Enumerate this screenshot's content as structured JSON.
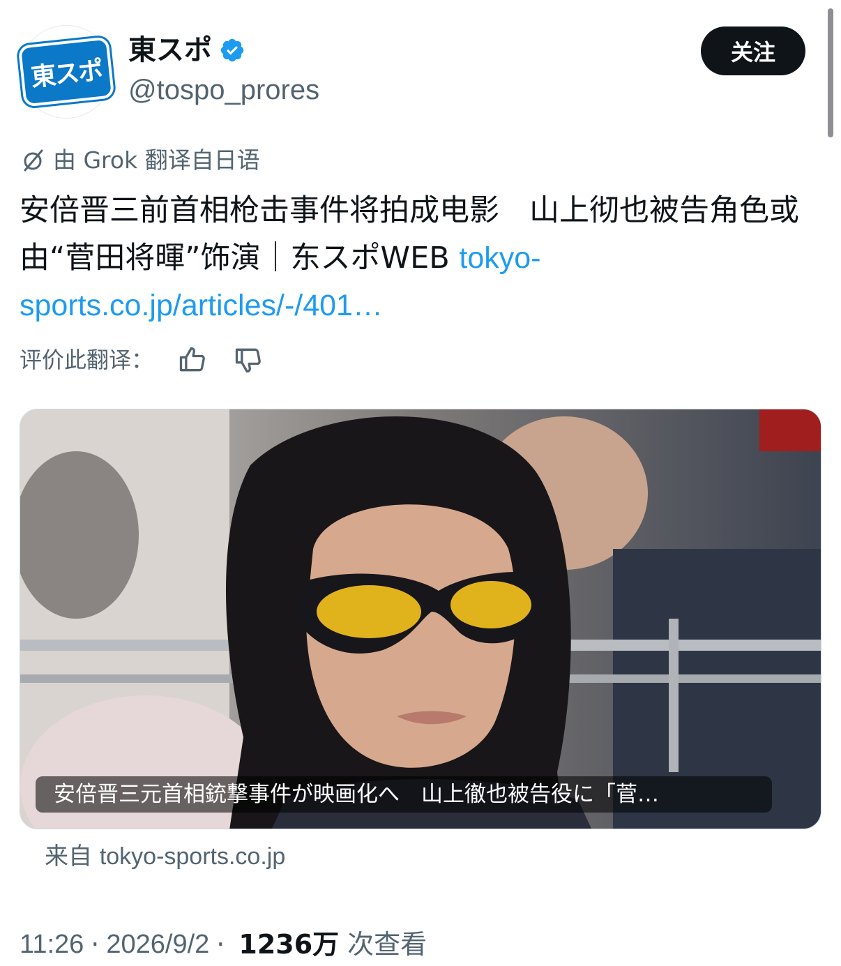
{
  "header": {
    "avatar_text": "東スポ",
    "display_name": "東スポ",
    "handle": "@tospo_prores",
    "follow_label": "关注"
  },
  "translation": {
    "label": "由 Grok 翻译自日语",
    "rate_label": "评价此翻译："
  },
  "tweet": {
    "text": "安倍晋三前首相枪击事件将拍成电影　山上彻也被告角色或由“菅田将暉”饰演｜东スポWEB ",
    "link": "tokyo-sports.co.jp/articles/-/401…"
  },
  "card": {
    "caption": "安倍晋三元首相銃撃事件が映画化へ　山上徹也被告役に「菅…",
    "source_prefix": "来自 ",
    "source_domain": "tokyo-sports.co.jp"
  },
  "meta": {
    "time": "11:26",
    "date": "2026/9/2",
    "views_count": "1236万",
    "views_label": "次查看",
    "separator": "·"
  },
  "colors": {
    "accent": "#1d9bf0",
    "text": "#0f1419",
    "secondary": "#536471"
  }
}
